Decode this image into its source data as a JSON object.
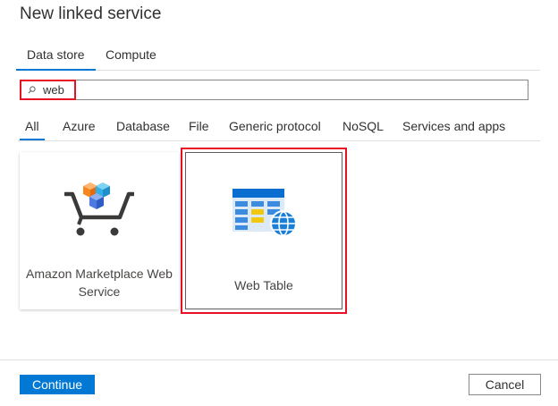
{
  "dialog": {
    "title": "New linked service"
  },
  "tabs": [
    {
      "label": "Data store",
      "active": true
    },
    {
      "label": "Compute",
      "active": false
    }
  ],
  "search": {
    "value": "web",
    "icon": "search-icon"
  },
  "filters": [
    {
      "label": "All",
      "active": true
    },
    {
      "label": "Azure",
      "active": false
    },
    {
      "label": "Database",
      "active": false
    },
    {
      "label": "File",
      "active": false
    },
    {
      "label": "Generic protocol",
      "active": false
    },
    {
      "label": "NoSQL",
      "active": false
    },
    {
      "label": "Services and apps",
      "active": false
    }
  ],
  "connectors": [
    {
      "name": "Amazon Marketplace Web Service",
      "icon": "shopping-cart-icon"
    },
    {
      "name": "Web Table",
      "icon": "web-table-icon",
      "selected": true
    }
  ],
  "footer": {
    "continue_label": "Continue",
    "cancel_label": "Cancel"
  },
  "colors": {
    "accent": "#0078d4",
    "highlight": "#e81123"
  }
}
